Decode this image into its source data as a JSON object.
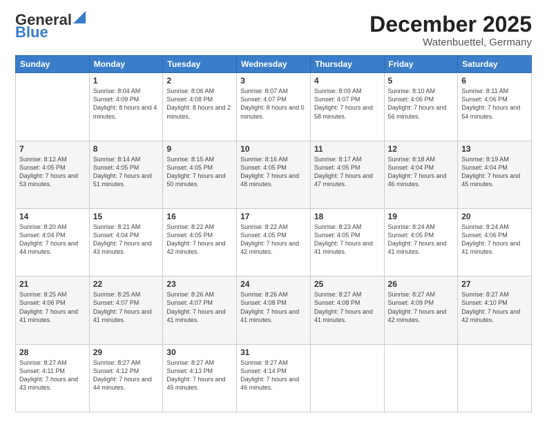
{
  "header": {
    "logo_general": "General",
    "logo_blue": "Blue",
    "month_title": "December 2025",
    "location": "Watenbuettel, Germany"
  },
  "days_of_week": [
    "Sunday",
    "Monday",
    "Tuesday",
    "Wednesday",
    "Thursday",
    "Friday",
    "Saturday"
  ],
  "weeks": [
    [
      {
        "day": "",
        "sunrise": "",
        "sunset": "",
        "daylight": "",
        "empty": true
      },
      {
        "day": "1",
        "sunrise": "Sunrise: 8:04 AM",
        "sunset": "Sunset: 4:09 PM",
        "daylight": "Daylight: 8 hours and 4 minutes.",
        "empty": false
      },
      {
        "day": "2",
        "sunrise": "Sunrise: 8:06 AM",
        "sunset": "Sunset: 4:08 PM",
        "daylight": "Daylight: 8 hours and 2 minutes.",
        "empty": false
      },
      {
        "day": "3",
        "sunrise": "Sunrise: 8:07 AM",
        "sunset": "Sunset: 4:07 PM",
        "daylight": "Daylight: 8 hours and 0 minutes.",
        "empty": false
      },
      {
        "day": "4",
        "sunrise": "Sunrise: 8:09 AM",
        "sunset": "Sunset: 4:07 PM",
        "daylight": "Daylight: 7 hours and 58 minutes.",
        "empty": false
      },
      {
        "day": "5",
        "sunrise": "Sunrise: 8:10 AM",
        "sunset": "Sunset: 4:06 PM",
        "daylight": "Daylight: 7 hours and 56 minutes.",
        "empty": false
      },
      {
        "day": "6",
        "sunrise": "Sunrise: 8:11 AM",
        "sunset": "Sunset: 4:06 PM",
        "daylight": "Daylight: 7 hours and 54 minutes.",
        "empty": false
      }
    ],
    [
      {
        "day": "7",
        "sunrise": "Sunrise: 8:12 AM",
        "sunset": "Sunset: 4:05 PM",
        "daylight": "Daylight: 7 hours and 53 minutes.",
        "empty": false
      },
      {
        "day": "8",
        "sunrise": "Sunrise: 8:14 AM",
        "sunset": "Sunset: 4:05 PM",
        "daylight": "Daylight: 7 hours and 51 minutes.",
        "empty": false
      },
      {
        "day": "9",
        "sunrise": "Sunrise: 8:15 AM",
        "sunset": "Sunset: 4:05 PM",
        "daylight": "Daylight: 7 hours and 50 minutes.",
        "empty": false
      },
      {
        "day": "10",
        "sunrise": "Sunrise: 8:16 AM",
        "sunset": "Sunset: 4:05 PM",
        "daylight": "Daylight: 7 hours and 48 minutes.",
        "empty": false
      },
      {
        "day": "11",
        "sunrise": "Sunrise: 8:17 AM",
        "sunset": "Sunset: 4:05 PM",
        "daylight": "Daylight: 7 hours and 47 minutes.",
        "empty": false
      },
      {
        "day": "12",
        "sunrise": "Sunrise: 8:18 AM",
        "sunset": "Sunset: 4:04 PM",
        "daylight": "Daylight: 7 hours and 46 minutes.",
        "empty": false
      },
      {
        "day": "13",
        "sunrise": "Sunrise: 8:19 AM",
        "sunset": "Sunset: 4:04 PM",
        "daylight": "Daylight: 7 hours and 45 minutes.",
        "empty": false
      }
    ],
    [
      {
        "day": "14",
        "sunrise": "Sunrise: 8:20 AM",
        "sunset": "Sunset: 4:04 PM",
        "daylight": "Daylight: 7 hours and 44 minutes.",
        "empty": false
      },
      {
        "day": "15",
        "sunrise": "Sunrise: 8:21 AM",
        "sunset": "Sunset: 4:04 PM",
        "daylight": "Daylight: 7 hours and 43 minutes.",
        "empty": false
      },
      {
        "day": "16",
        "sunrise": "Sunrise: 8:22 AM",
        "sunset": "Sunset: 4:05 PM",
        "daylight": "Daylight: 7 hours and 42 minutes.",
        "empty": false
      },
      {
        "day": "17",
        "sunrise": "Sunrise: 8:22 AM",
        "sunset": "Sunset: 4:05 PM",
        "daylight": "Daylight: 7 hours and 42 minutes.",
        "empty": false
      },
      {
        "day": "18",
        "sunrise": "Sunrise: 8:23 AM",
        "sunset": "Sunset: 4:05 PM",
        "daylight": "Daylight: 7 hours and 41 minutes.",
        "empty": false
      },
      {
        "day": "19",
        "sunrise": "Sunrise: 8:24 AM",
        "sunset": "Sunset: 4:05 PM",
        "daylight": "Daylight: 7 hours and 41 minutes.",
        "empty": false
      },
      {
        "day": "20",
        "sunrise": "Sunrise: 8:24 AM",
        "sunset": "Sunset: 4:06 PM",
        "daylight": "Daylight: 7 hours and 41 minutes.",
        "empty": false
      }
    ],
    [
      {
        "day": "21",
        "sunrise": "Sunrise: 8:25 AM",
        "sunset": "Sunset: 4:06 PM",
        "daylight": "Daylight: 7 hours and 41 minutes.",
        "empty": false
      },
      {
        "day": "22",
        "sunrise": "Sunrise: 8:25 AM",
        "sunset": "Sunset: 4:07 PM",
        "daylight": "Daylight: 7 hours and 41 minutes.",
        "empty": false
      },
      {
        "day": "23",
        "sunrise": "Sunrise: 8:26 AM",
        "sunset": "Sunset: 4:07 PM",
        "daylight": "Daylight: 7 hours and 41 minutes.",
        "empty": false
      },
      {
        "day": "24",
        "sunrise": "Sunrise: 8:26 AM",
        "sunset": "Sunset: 4:08 PM",
        "daylight": "Daylight: 7 hours and 41 minutes.",
        "empty": false
      },
      {
        "day": "25",
        "sunrise": "Sunrise: 8:27 AM",
        "sunset": "Sunset: 4:08 PM",
        "daylight": "Daylight: 7 hours and 41 minutes.",
        "empty": false
      },
      {
        "day": "26",
        "sunrise": "Sunrise: 8:27 AM",
        "sunset": "Sunset: 4:09 PM",
        "daylight": "Daylight: 7 hours and 42 minutes.",
        "empty": false
      },
      {
        "day": "27",
        "sunrise": "Sunrise: 8:27 AM",
        "sunset": "Sunset: 4:10 PM",
        "daylight": "Daylight: 7 hours and 42 minutes.",
        "empty": false
      }
    ],
    [
      {
        "day": "28",
        "sunrise": "Sunrise: 8:27 AM",
        "sunset": "Sunset: 4:11 PM",
        "daylight": "Daylight: 7 hours and 43 minutes.",
        "empty": false
      },
      {
        "day": "29",
        "sunrise": "Sunrise: 8:27 AM",
        "sunset": "Sunset: 4:12 PM",
        "daylight": "Daylight: 7 hours and 44 minutes.",
        "empty": false
      },
      {
        "day": "30",
        "sunrise": "Sunrise: 8:27 AM",
        "sunset": "Sunset: 4:13 PM",
        "daylight": "Daylight: 7 hours and 45 minutes.",
        "empty": false
      },
      {
        "day": "31",
        "sunrise": "Sunrise: 8:27 AM",
        "sunset": "Sunset: 4:14 PM",
        "daylight": "Daylight: 7 hours and 46 minutes.",
        "empty": false
      },
      {
        "day": "",
        "sunrise": "",
        "sunset": "",
        "daylight": "",
        "empty": true
      },
      {
        "day": "",
        "sunrise": "",
        "sunset": "",
        "daylight": "",
        "empty": true
      },
      {
        "day": "",
        "sunrise": "",
        "sunset": "",
        "daylight": "",
        "empty": true
      }
    ]
  ]
}
